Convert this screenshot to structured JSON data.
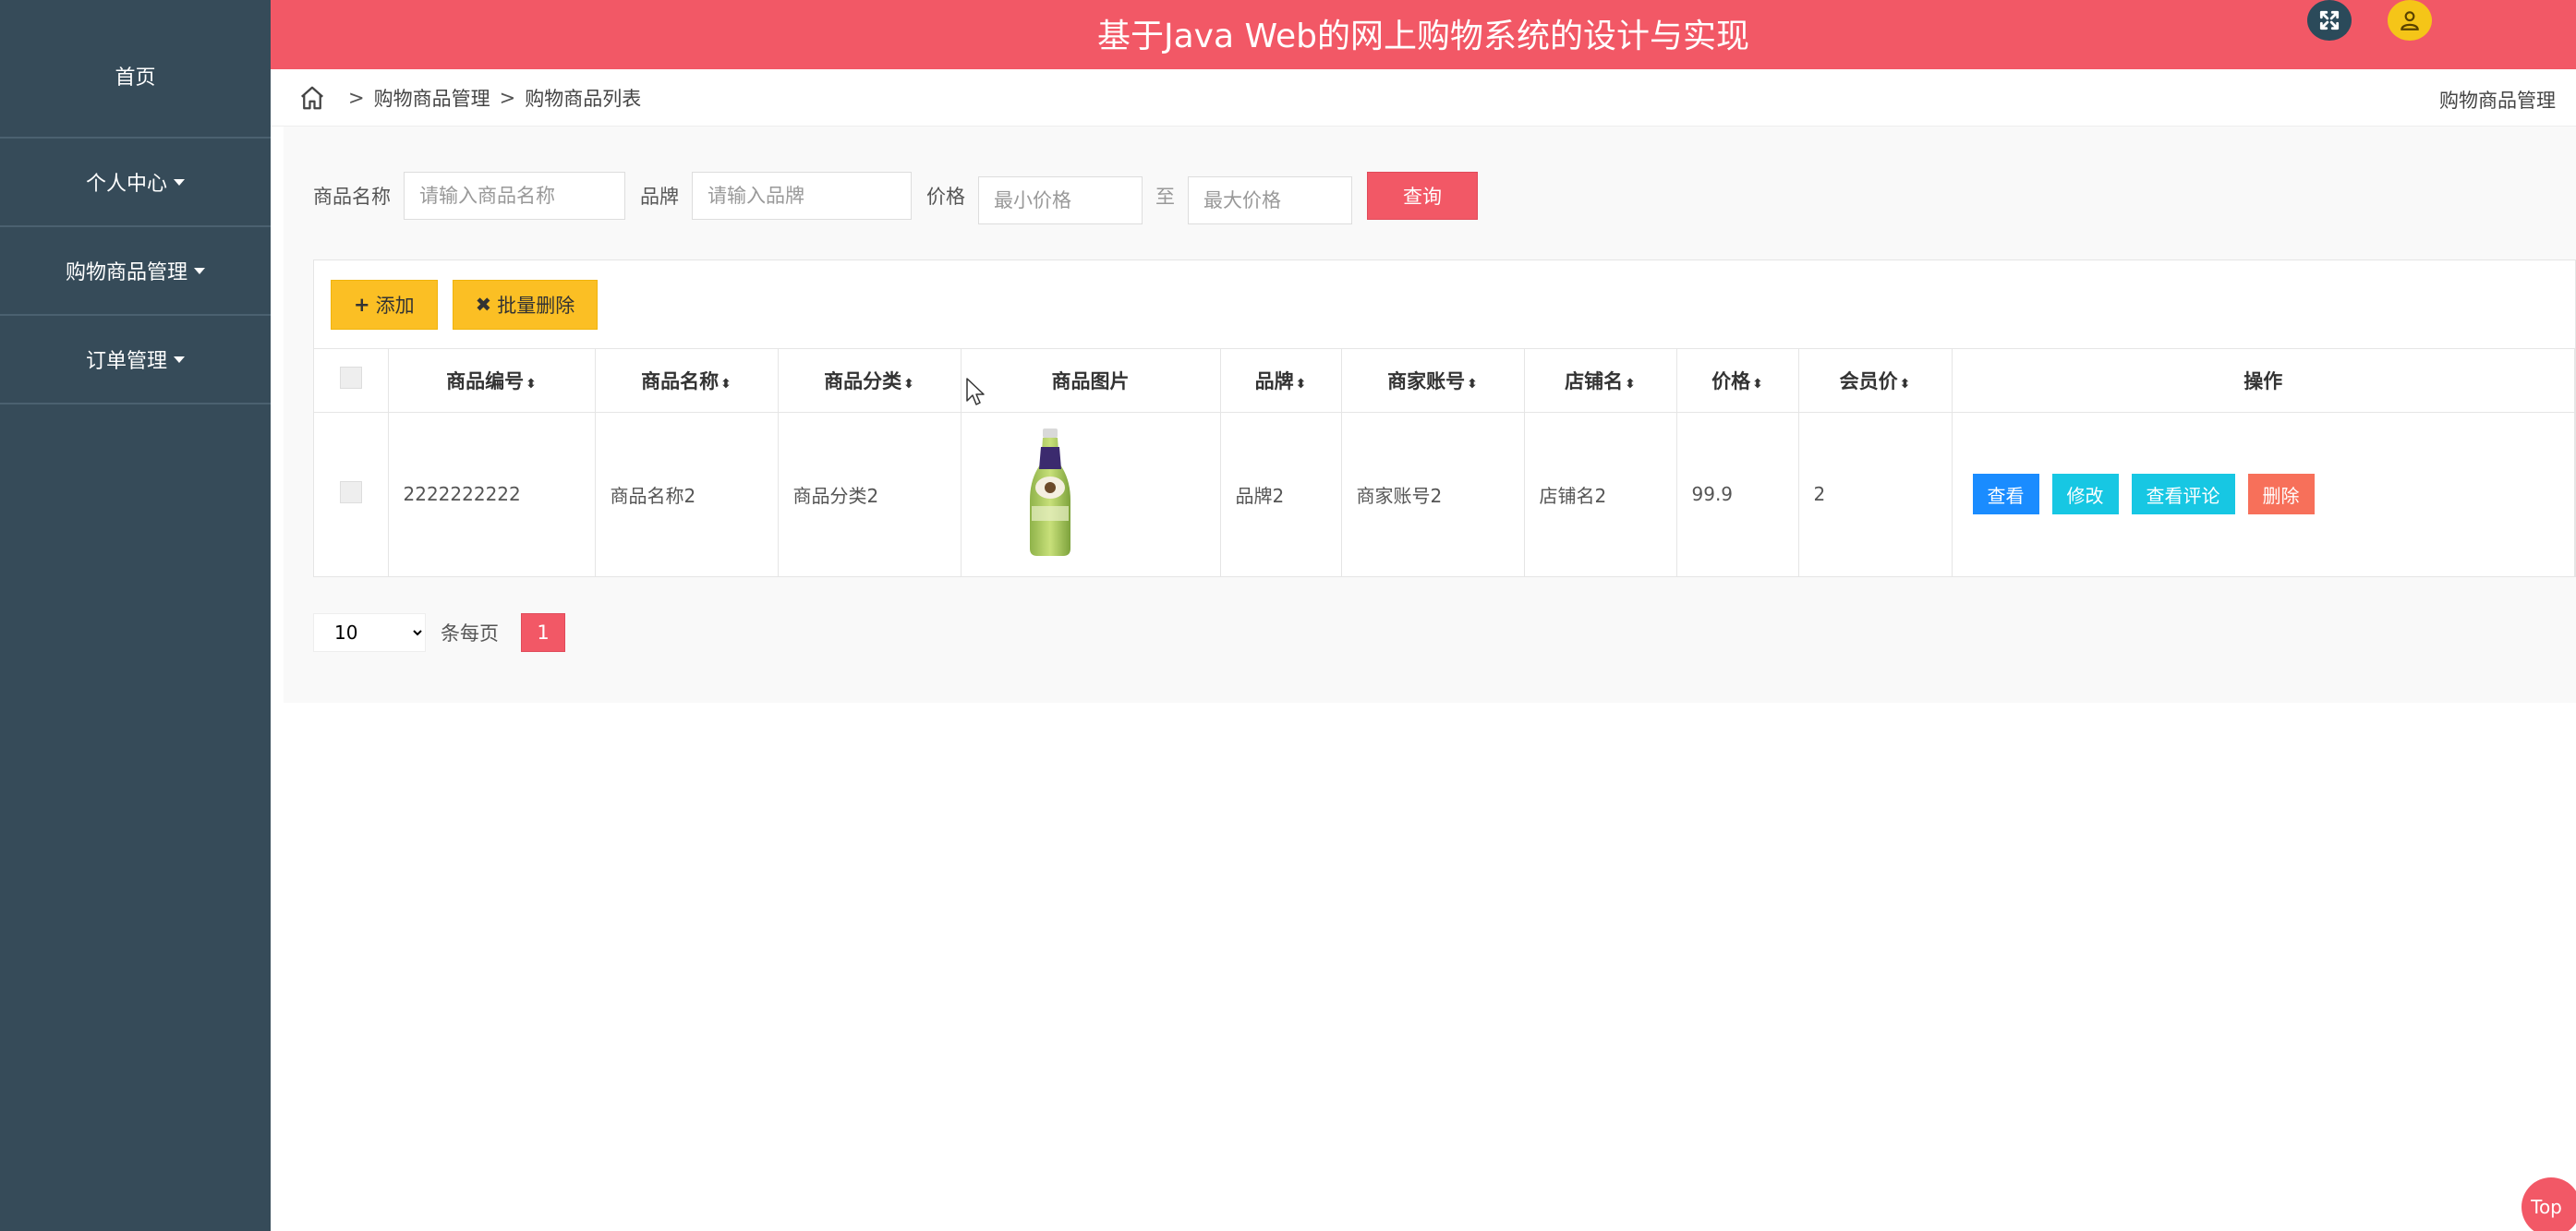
{
  "header": {
    "title": "基于Java Web的网上购物系统的设计与实现"
  },
  "sidebar": {
    "items": [
      {
        "label": "首页",
        "has_caret": false
      },
      {
        "label": "个人中心",
        "has_caret": true
      },
      {
        "label": "购物商品管理",
        "has_caret": true
      },
      {
        "label": "订单管理",
        "has_caret": true
      }
    ]
  },
  "breadcrumb": {
    "level1": "购物商品管理",
    "level2": "购物商品列表",
    "sep": ">",
    "right_title": "购物商品管理"
  },
  "filter": {
    "name_label": "商品名称",
    "name_placeholder": "请输入商品名称",
    "brand_label": "品牌",
    "brand_placeholder": "请输入品牌",
    "price_label": "价格",
    "min_placeholder": "最小价格",
    "to_label": "至",
    "max_placeholder": "最大价格",
    "search_label": "查询"
  },
  "toolbar": {
    "add_label": "添加",
    "batch_delete_label": "批量删除"
  },
  "table": {
    "columns": [
      "商品编号",
      "商品名称",
      "商品分类",
      "商品图片",
      "品牌",
      "商家账号",
      "店铺名",
      "价格",
      "会员价",
      "操作"
    ],
    "rows": [
      {
        "code": "2222222222",
        "name": "商品名称2",
        "category": "商品分类2",
        "brand": "品牌2",
        "merchant": "商家账号2",
        "shop": "店铺名2",
        "price": "99.9",
        "member_price": "2"
      }
    ],
    "actions": {
      "view": "查看",
      "edit": "修改",
      "comments": "查看评论",
      "delete": "删除"
    }
  },
  "pager": {
    "page_size": "10",
    "per_page_label": "条每页",
    "current_page": "1"
  },
  "back_to_top": "Top",
  "colors": {
    "header": "#f25866",
    "sidebar": "#364b59",
    "accent_yellow": "#fbbf24",
    "view_blue": "#1a8cff",
    "cyan": "#17c7e3",
    "delete_orange": "#f7705a"
  }
}
